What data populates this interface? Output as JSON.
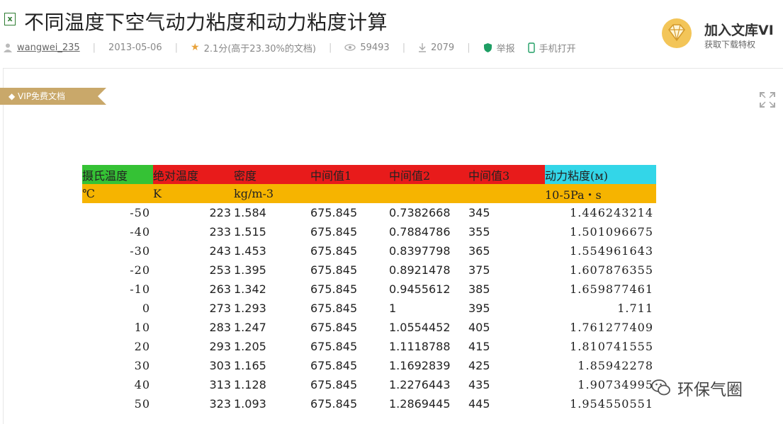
{
  "header": {
    "doc_type_icon": "excel-file-icon",
    "title": "不同温度下空气动力粘度和动力粘度计算",
    "meta": {
      "author": "wangwei_235",
      "date": "2013-05-06",
      "rating": "2.1分(高于23.30%的文档)",
      "views": "59493",
      "downloads": "2079",
      "report_label": "举报",
      "mobile_label": "手机打开"
    },
    "vip": {
      "title": "加入文库VI",
      "subtitle": "获取下载特权"
    }
  },
  "document": {
    "vip_tag": "VIP免费文档",
    "table": {
      "headers": [
        "摄氏温度",
        "绝对温度",
        "密度",
        "中间值1",
        "中间值2",
        "中间值3",
        "动力粘度(м)"
      ],
      "header_colors": [
        "#35c235",
        "#e81b1b",
        "#e81b1b",
        "#e81b1b",
        "#e81b1b",
        "#e81b1b",
        "#33d6e8"
      ],
      "units": [
        "℃",
        "K",
        "kg/m-3",
        "",
        "",
        "",
        "10-5Pa・s"
      ],
      "rows": [
        [
          "-50",
          "223",
          "1.584",
          "675.845",
          "0.7382668",
          "345",
          "1.446243214"
        ],
        [
          "-40",
          "233",
          "1.515",
          "675.845",
          "0.7884786",
          "355",
          "1.501096675"
        ],
        [
          "-30",
          "243",
          "1.453",
          "675.845",
          "0.8397798",
          "365",
          "1.554961643"
        ],
        [
          "-20",
          "253",
          "1.395",
          "675.845",
          "0.8921478",
          "375",
          "1.607876355"
        ],
        [
          "-10",
          "263",
          "1.342",
          "675.845",
          "0.9455612",
          "385",
          "1.659877461"
        ],
        [
          "0",
          "273",
          "1.293",
          "675.845",
          "1",
          "395",
          "1.711"
        ],
        [
          "10",
          "283",
          "1.247",
          "675.845",
          "1.0554452",
          "405",
          "1.761277409"
        ],
        [
          "20",
          "293",
          "1.205",
          "675.845",
          "1.1118788",
          "415",
          "1.810741555"
        ],
        [
          "30",
          "303",
          "1.165",
          "675.845",
          "1.1692839",
          "425",
          "1.85942278"
        ],
        [
          "40",
          "313",
          "1.128",
          "675.845",
          "1.2276443",
          "435",
          "1.90734995"
        ],
        [
          "50",
          "323",
          "1.093",
          "675.845",
          "1.2869445",
          "445",
          "1.954550551"
        ]
      ]
    }
  },
  "watermark": {
    "text": "环保气圈",
    "icon": "wechat-icon"
  }
}
